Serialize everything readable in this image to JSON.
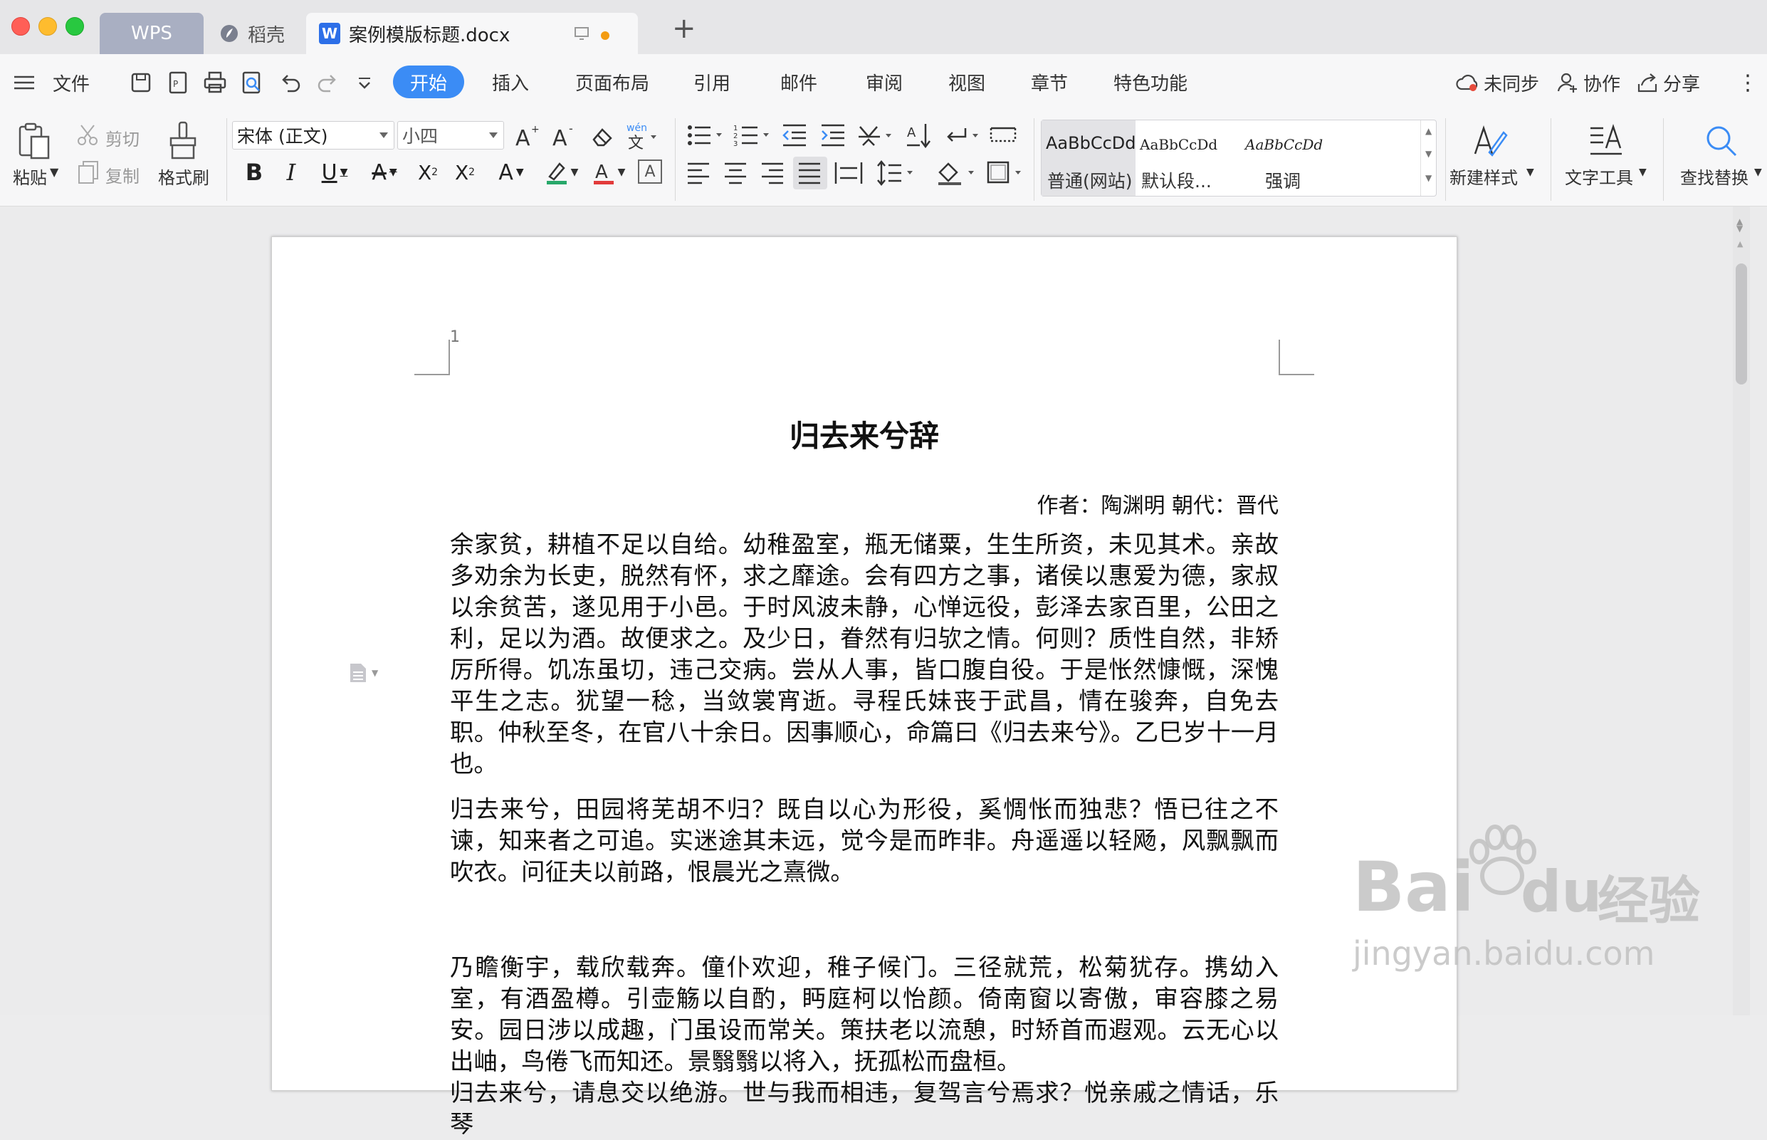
{
  "window": {
    "tabs": [
      {
        "label": "WPS"
      },
      {
        "label": "稻壳"
      },
      {
        "label": "案例模版标题.docx"
      }
    ]
  },
  "menubar": {
    "file_label": "文件",
    "tabs": [
      "开始",
      "插入",
      "页面布局",
      "引用",
      "邮件",
      "审阅",
      "视图",
      "章节",
      "特色功能"
    ],
    "active_tab": "开始",
    "sync_label": "未同步",
    "collab_label": "协作",
    "share_label": "分享"
  },
  "ribbon": {
    "paste_label": "粘贴",
    "cut_label": "剪切",
    "copy_label": "复制",
    "format_painter_label": "格式刷",
    "font_name": "宋体 (正文)",
    "font_size": "小四",
    "styles": [
      {
        "sample": "AaBbCcDd",
        "name": "普通(网站)"
      },
      {
        "sample": "AaBbCcDd",
        "name": "默认段..."
      },
      {
        "sample": "AaBbCcDd",
        "name": "强调"
      }
    ],
    "new_style_label": "新建样式",
    "text_tools_label": "文字工具",
    "find_replace_label": "查找替换"
  },
  "document": {
    "page_number": "1",
    "title": "归去来兮辞",
    "author_line": "作者：陶渊明  朝代：晋代",
    "paragraphs": [
      "余家贫，耕植不足以自给。幼稚盈室，瓶无储粟，生生所资，未见其术。亲故多劝余为长吏，脱然有怀，求之靡途。会有四方之事，诸侯以惠爱为德，家叔以余贫苦，遂见用于小邑。于时风波未静，心惮远役，彭泽去家百里，公田之利，足以为酒。故便求之。及少日，眷然有归欤之情。何则？质性自然，非矫厉所得。饥冻虽切，违己交病。尝从人事，皆口腹自役。于是怅然慷慨，深愧平生之志。犹望一稔，当敛裳宵逝。寻程氏妹丧于武昌，情在骏奔，自免去职。仲秋至冬，在官八十余日。因事顺心，命篇曰《归去来兮》。乙巳岁十一月也。",
      "归去来兮，田园将芜胡不归？既自以心为形役，奚惆怅而独悲？悟已往之不谏，知来者之可追。实迷途其未远，觉今是而昨非。舟遥遥以轻飏，风飘飘而吹衣。问征夫以前路，恨晨光之熹微。",
      "乃瞻衡宇，载欣载奔。僮仆欢迎，稚子候门。三径就荒，松菊犹存。携幼入室，有酒盈樽。引壶觞以自酌，眄庭柯以怡颜。倚南窗以寄傲，审容膝之易安。园日涉以成趣，门虽设而常关。策扶老以流憩，时矫首而遐观。云无心以出岫，鸟倦飞而知还。景翳翳以将入，抚孤松而盘桓。",
      "归去来兮，请息交以绝游。世与我而相违，复驾言兮焉求？悦亲戚之情话，乐琴"
    ]
  },
  "watermark": {
    "brand": "Bai",
    "brand_tail": "du",
    "brand_cn": "经验",
    "url": "jingyan.baidu.com"
  }
}
